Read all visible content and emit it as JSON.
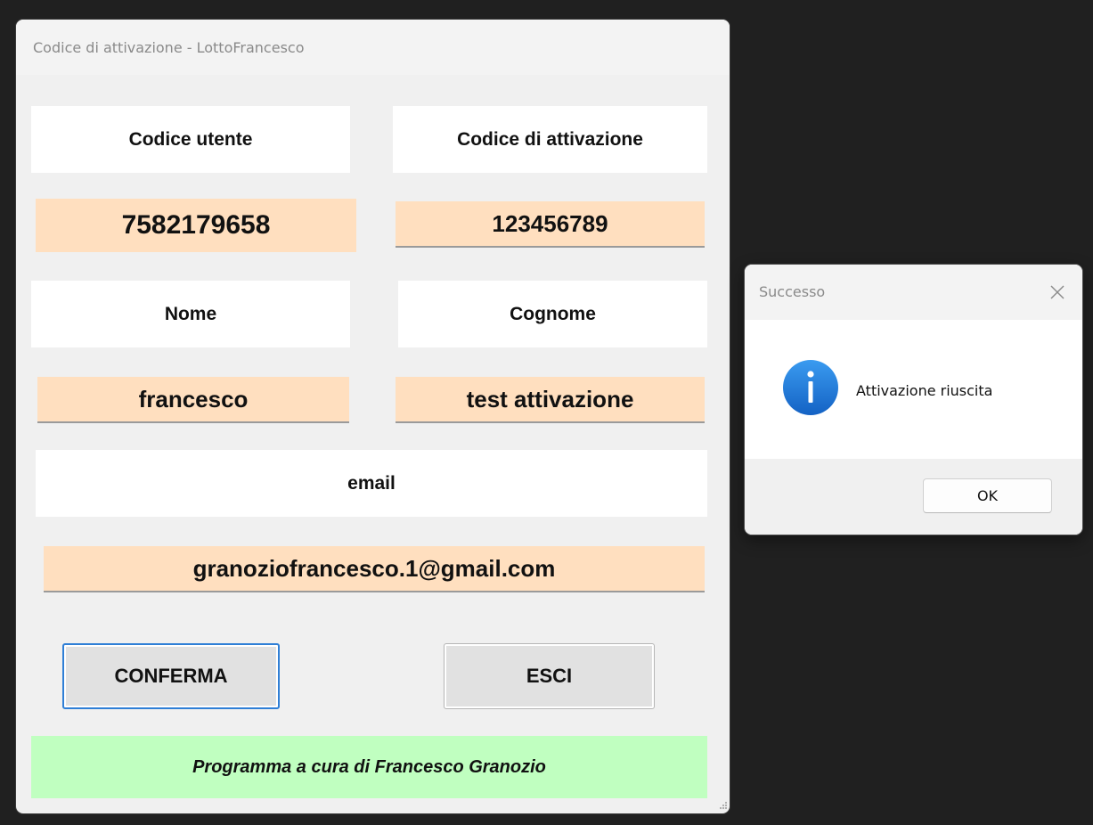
{
  "main_window": {
    "title": "Codice di attivazione - LottoFrancesco",
    "labels": {
      "user_code": "Codice utente",
      "activation_code": "Codice di attivazione",
      "first_name": "Nome",
      "last_name": "Cognome",
      "email": "email"
    },
    "values": {
      "user_code": "7582179658",
      "activation_code": "123456789",
      "first_name": "francesco",
      "last_name": "test attivazione",
      "email": "granoziofrancesco.1@gmail.com"
    },
    "buttons": {
      "confirm": "CONFERMA",
      "exit": "ESCI"
    },
    "footer": "Programma a cura di Francesco Granozio"
  },
  "dialog": {
    "title": "Successo",
    "message": "Attivazione riuscita",
    "ok_label": "OK",
    "icon": "info-icon"
  },
  "colors": {
    "value_background": "#ffdfbf",
    "footer_background": "#c0ffc0",
    "confirm_border": "#2f7fd6",
    "info_icon": "#1a6fd0"
  }
}
